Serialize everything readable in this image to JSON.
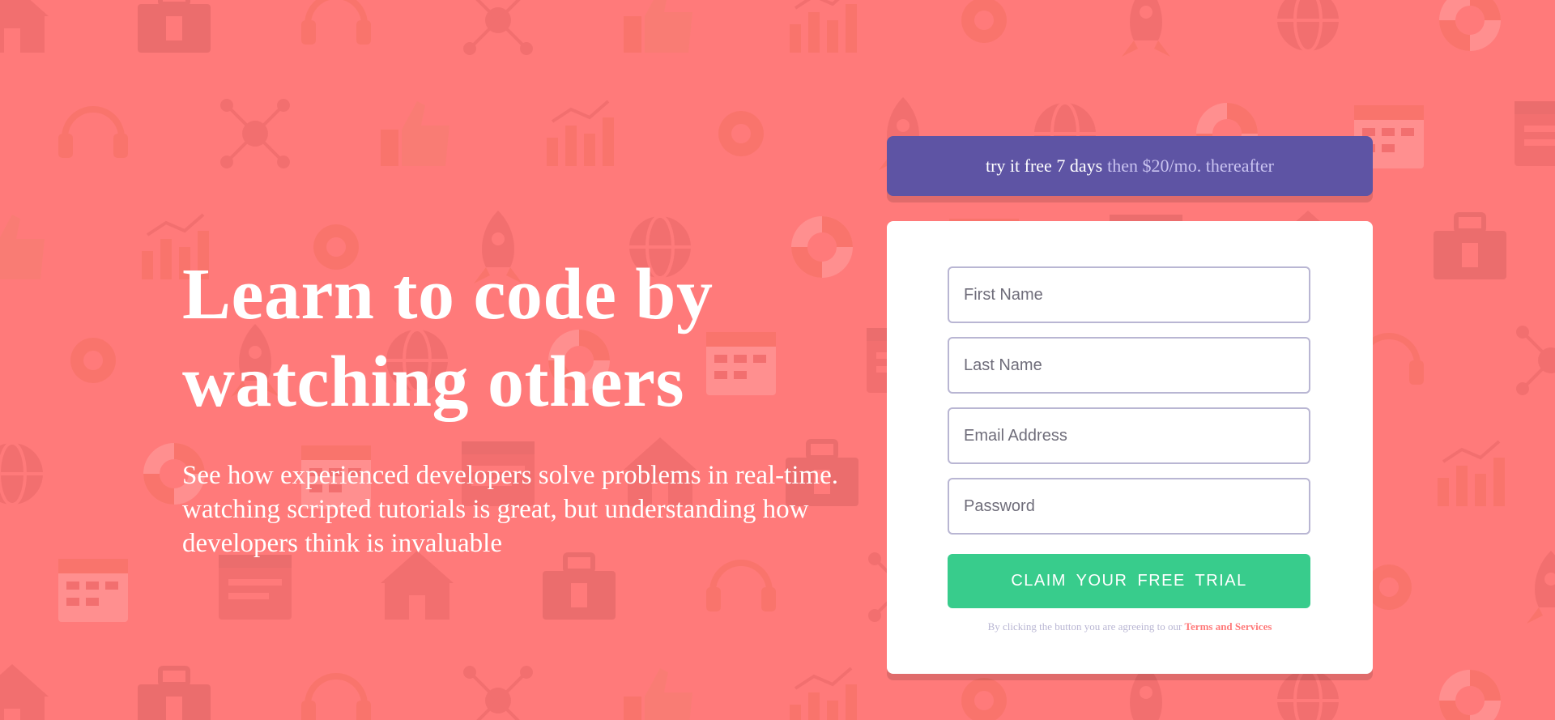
{
  "colors": {
    "background": "#ff7a7a",
    "promo_bg": "#5e54a4",
    "submit_bg": "#38cc8c",
    "field_border": "#b9b6d3",
    "link": "#ff7a7a"
  },
  "hero": {
    "heading_line1": "Learn to code by",
    "heading_line2": "watching others",
    "description": "See how experienced developers solve problems in real-time. watching scripted tutorials is great, but understanding how developers think is invaluable"
  },
  "promo": {
    "strong": "try it free 7 days",
    "rest": "then $20/mo. thereafter"
  },
  "form": {
    "first_name_placeholder": "First Name",
    "last_name_placeholder": "Last Name",
    "email_placeholder": "Email Address",
    "password_placeholder": "Password",
    "submit_label": "CLAIM YOUR FREE TRIAL",
    "terms_text": "By clicking the button you are agreeing to our",
    "terms_link": "Terms and Services"
  },
  "background_icons": [
    "house-icon",
    "toolbox-icon",
    "headset-icon",
    "network-icon",
    "thumbs-up-icon",
    "chart-icon",
    "gear-icon",
    "rocket-icon",
    "globe-icon",
    "lifebuoy-icon",
    "calendar-icon",
    "browser-window-icon"
  ]
}
